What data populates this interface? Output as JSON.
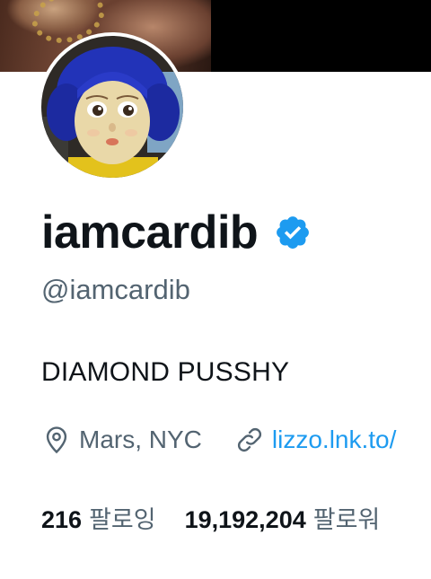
{
  "profile": {
    "display_name": "iamcardib",
    "handle": "@iamcardib",
    "verified_icon": "verified-badge-icon",
    "bio": "DIAMOND PUSSHY",
    "location": "Mars, NYC",
    "link": "lizzo.lnk.to/",
    "following_count": "216",
    "following_label": "팔로잉",
    "followers_count": "19,192,204",
    "followers_label": "팔로워"
  },
  "colors": {
    "accent": "#1d9bf0",
    "secondary_text": "#536471",
    "primary_text": "#0f1419"
  }
}
